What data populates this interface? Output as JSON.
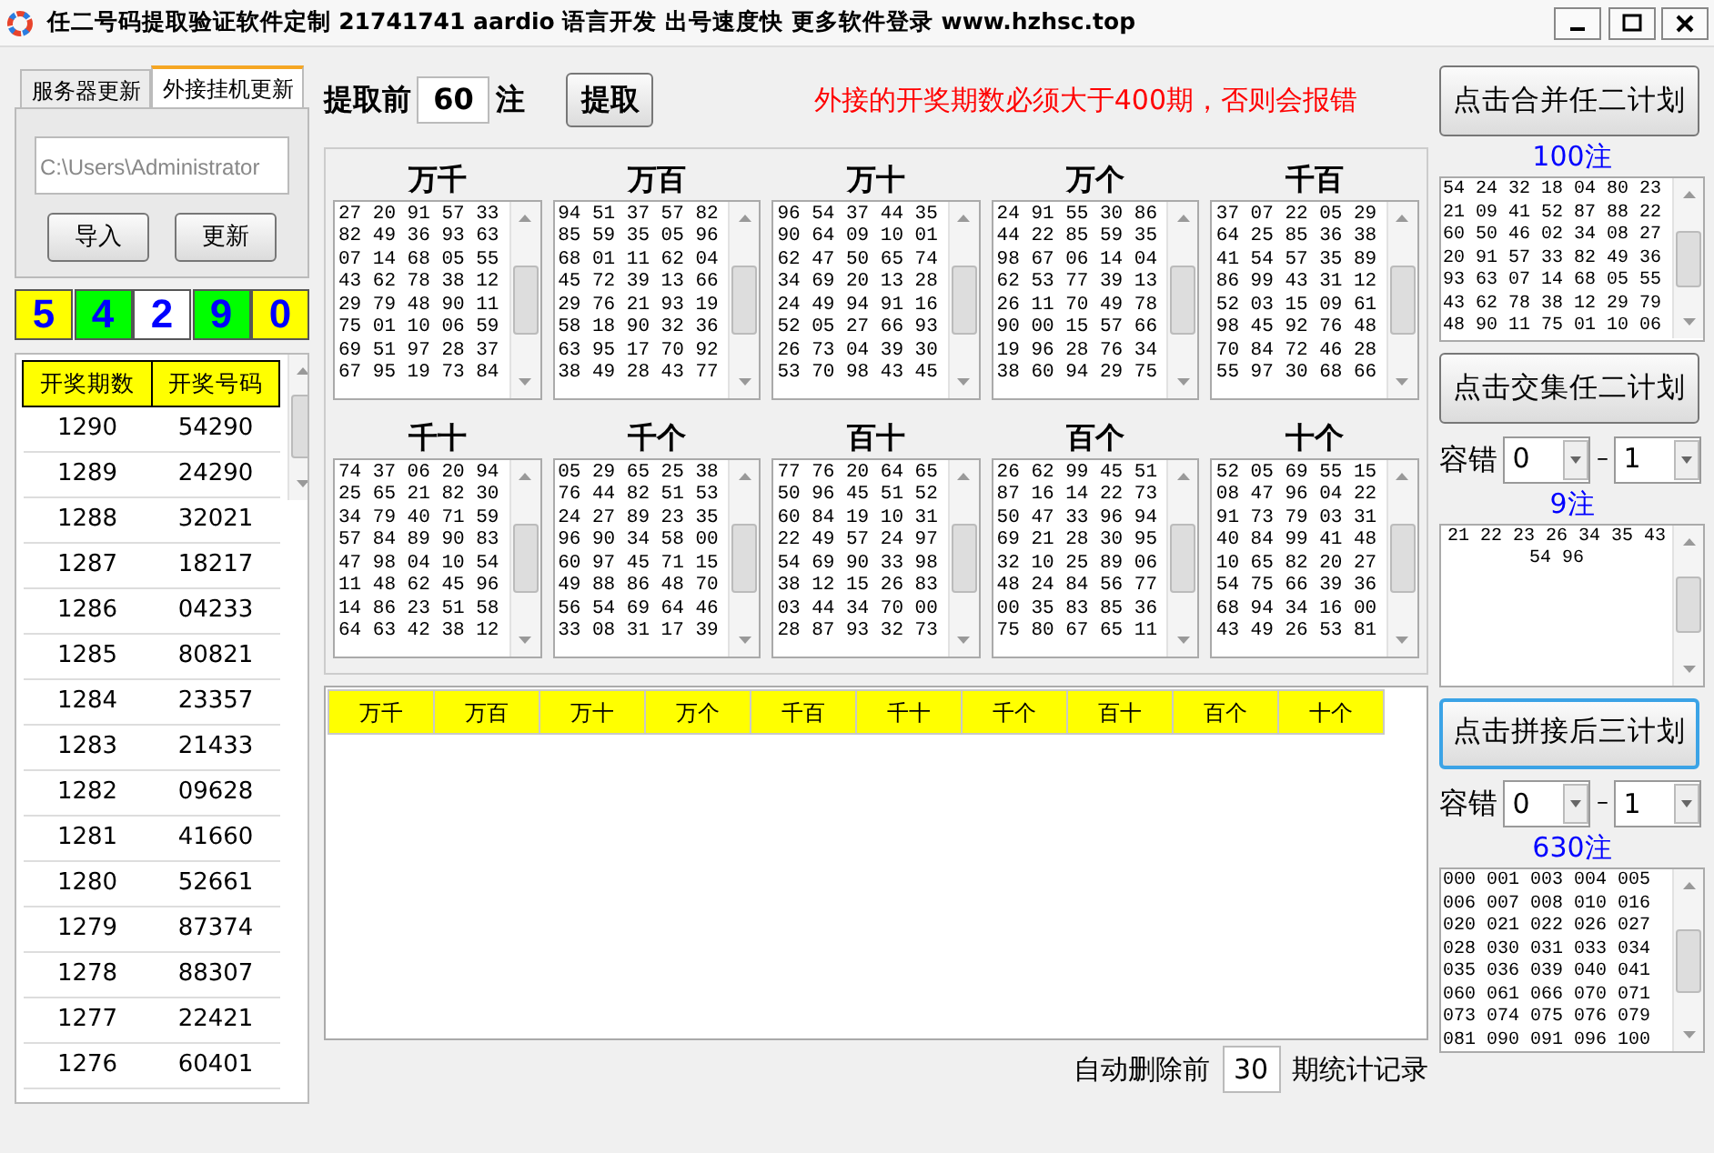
{
  "window": {
    "title": "任二号码提取验证软件定制 21741741 aardio 语言开发 出号速度快 更多软件登录 www.hzhsc.top"
  },
  "left_panel": {
    "tabs": [
      {
        "label": "服务器更新",
        "selected": false
      },
      {
        "label": "外接挂机更新",
        "selected": true
      }
    ],
    "path_field": {
      "value": "C:\\Users\\Administrator"
    },
    "buttons": [
      "导入",
      "更新"
    ],
    "digits": [
      {
        "text": "5",
        "color": "#ffff00"
      },
      {
        "text": "4",
        "color": "#00ff00"
      },
      {
        "text": "2",
        "color": "#ffffff"
      },
      {
        "text": "9",
        "color": "#00ff00"
      },
      {
        "text": "0",
        "color": "#ffff00"
      }
    ],
    "draw_table": {
      "columns": [
        "开奖期数",
        "开奖号码"
      ],
      "rows": [
        [
          "1290",
          "54290"
        ],
        [
          "1289",
          "24290"
        ],
        [
          "1288",
          "32021"
        ],
        [
          "1287",
          "18217"
        ],
        [
          "1286",
          "04233"
        ],
        [
          "1285",
          "80821"
        ],
        [
          "1284",
          "23357"
        ],
        [
          "1283",
          "21433"
        ],
        [
          "1282",
          "09628"
        ],
        [
          "1281",
          "41660"
        ],
        [
          "1280",
          "52661"
        ],
        [
          "1279",
          "87374"
        ],
        [
          "1278",
          "88307"
        ],
        [
          "1277",
          "22421"
        ],
        [
          "1276",
          "60401"
        ]
      ]
    }
  },
  "extract": {
    "label": "提取前",
    "count": "60",
    "unit": "注",
    "button": "提取",
    "warning": "外接的开奖期数必须大于400期，否则会报错"
  },
  "positions": [
    {
      "title": "万千",
      "lines": [
        "27 20 91 57 33",
        "82 49 36 93 63",
        "07 14 68 05 55",
        "43 62 78 38 12",
        "29 79 48 90 11",
        "75 01 10 06 59",
        "69 51 97 28 37",
        "67 95 19 73 84"
      ]
    },
    {
      "title": "万百",
      "lines": [
        "94 51 37 57 82",
        "85 59 35 05 96",
        "68 01 11 62 04",
        "45 72 39 13 66",
        "29 76 21 93 19",
        "58 18 90 32 36",
        "63 95 17 70 92",
        "38 49 28 43 77"
      ]
    },
    {
      "title": "万十",
      "lines": [
        "96 54 37 44 35",
        "90 64 09 10 01",
        "62 47 50 65 74",
        "34 69 20 13 28",
        "24 49 94 91 16",
        "52 05 27 66 93",
        "26 73 04 39 30",
        "53 70 98 43 45"
      ]
    },
    {
      "title": "万个",
      "lines": [
        "24 91 55 30 86",
        "44 22 85 59 35",
        "98 67 06 14 04",
        "62 53 77 39 13",
        "26 11 70 49 78",
        "90 00 15 57 66",
        "19 96 28 76 34",
        "38 60 94 29 75"
      ]
    },
    {
      "title": "千百",
      "lines": [
        "37 07 22 05 29",
        "64 25 85 36 38",
        "41 54 57 35 89",
        "86 99 43 31 12",
        "52 03 15 09 61",
        "98 45 92 76 48",
        "70 84 72 46 28",
        "55 97 30 68 66"
      ]
    },
    {
      "title": "千十",
      "lines": [
        "74 37 06 20 94",
        "25 65 21 82 30",
        "34 79 40 71 59",
        "57 84 89 90 83",
        "47 98 04 10 54",
        "11 48 62 45 96",
        "14 86 23 51 58",
        "64 63 42 38 12"
      ]
    },
    {
      "title": "千个",
      "lines": [
        "05 29 65 25 38",
        "76 44 82 51 53",
        "24 27 89 23 35",
        "96 90 34 58 00",
        "60 97 45 71 15",
        "49 88 86 48 70",
        "56 54 69 64 46",
        "33 08 31 17 39"
      ]
    },
    {
      "title": "百十",
      "lines": [
        "77 76 20 64 65",
        "50 96 45 51 52",
        "60 84 19 10 31",
        "22 49 57 24 97",
        "54 69 90 33 98",
        "38 12 15 26 83",
        "03 44 34 70 00",
        "28 87 93 32 73"
      ]
    },
    {
      "title": "百个",
      "lines": [
        "26 62 99 45 51",
        "87 16 14 22 73",
        "50 47 33 96 94",
        "69 21 28 30 95",
        "32 10 25 89 06",
        "48 24 84 56 77",
        "00 35 83 85 36",
        "75 80 67 65 11"
      ]
    },
    {
      "title": "十个",
      "lines": [
        "52 05 69 55 15",
        "08 47 96 04 22",
        "91 73 79 03 31",
        "40 84 99 41 48",
        "10 65 82 20 27",
        "54 75 66 39 36",
        "68 94 34 16 00",
        "43 49 26 53 81"
      ]
    }
  ],
  "results_table": {
    "columns": [
      "万千",
      "万百",
      "万十",
      "万个",
      "千百",
      "千十",
      "千个",
      "百十",
      "百个",
      "十个"
    ]
  },
  "auto_delete": {
    "label": "自动删除前",
    "count": "30",
    "suffix": "期统计记录"
  },
  "right_panel": {
    "plans": [
      {
        "button": "点击合并任二计划",
        "focused": false,
        "count": "100注",
        "centered": false,
        "lines": [
          "54 24 32 18 04 80 23",
          "21 09 41 52 87 88 22",
          "60 50 46 02 34 08 27",
          "20 91 57 33 82 49 36",
          "93 63 07 14 68 05 55",
          "43 62 78 38 12 29 79",
          "48 90 11 75 01 10 06"
        ]
      },
      {
        "button": "点击交集任二计划",
        "focused": false,
        "tolerance": {
          "label": "容错",
          "from": "0",
          "dash": "–",
          "to": "1"
        },
        "count": "9注",
        "centered": true,
        "lines": [
          "21 22 23 26 34 35 43",
          "54 96"
        ]
      },
      {
        "button": "点击拼接后三计划",
        "focused": true,
        "tolerance": {
          "label": "容错",
          "from": "0",
          "dash": "–",
          "to": "1"
        },
        "count": "630注",
        "centered": false,
        "lines": [
          "000 001 003 004 005",
          "006 007 008 010 016",
          "020 021 022 026 027",
          "028 030 031 033 034",
          "035 036 039 040 041",
          "060 061 066 070 071",
          "073 074 075 076 079",
          "081 090 091 096 100"
        ]
      }
    ]
  }
}
